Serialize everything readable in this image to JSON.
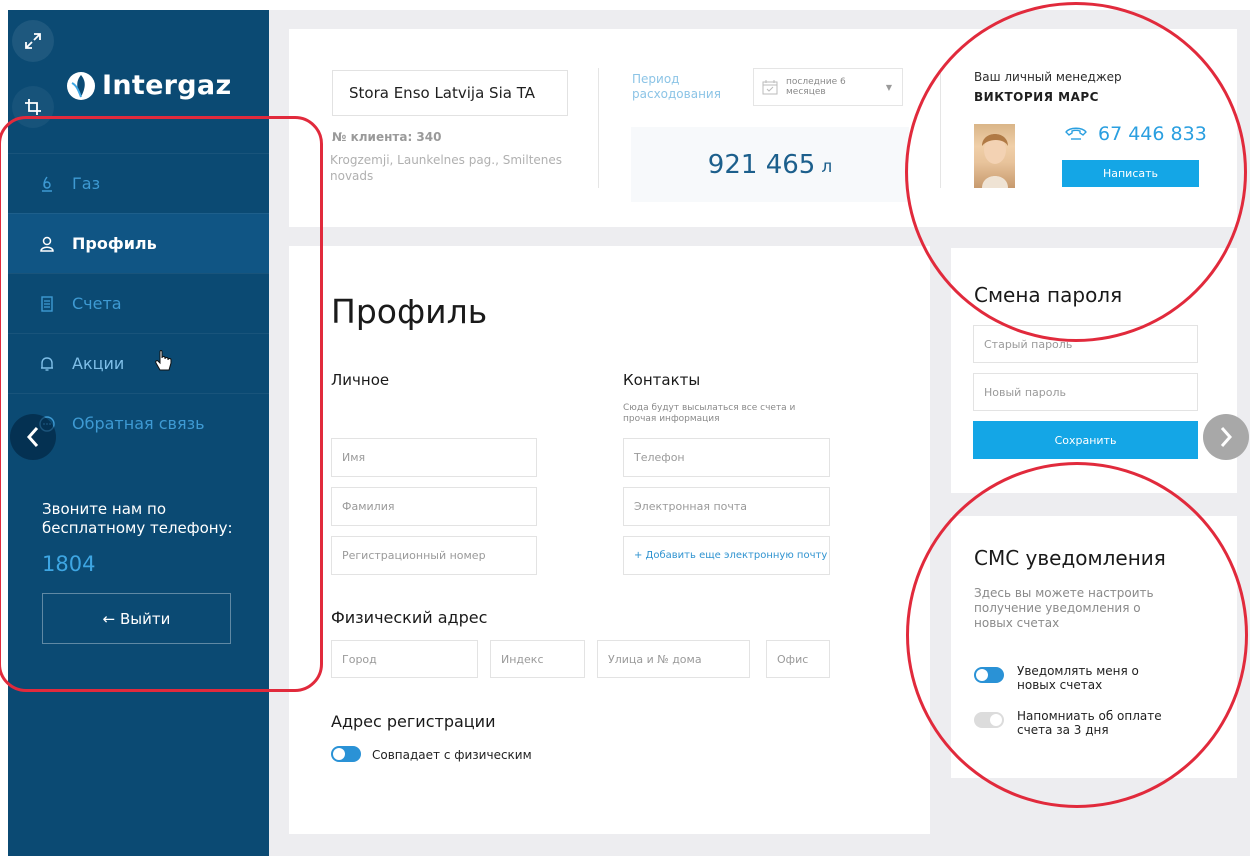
{
  "sidebar": {
    "brand": "Intergaz",
    "nav": [
      {
        "label": "Газ",
        "icon": "flame-icon",
        "active": false
      },
      {
        "label": "Профиль",
        "icon": "user-icon",
        "active": true
      },
      {
        "label": "Счета",
        "icon": "document-icon",
        "active": false
      },
      {
        "label": "Акции",
        "icon": "bell-icon",
        "active": false
      },
      {
        "label": "Обратная связь",
        "icon": "chat-icon",
        "active": false
      }
    ],
    "call_text": "Звоните нам по бесплатному телефону:",
    "call_number": "1804",
    "logout_label": "← Выйти"
  },
  "header": {
    "company": "Stora Enso Latvija Sia TA",
    "client_no": "№ клиента: 340",
    "address": "Krogzemji, Launkelnes pag., Smiltenes novads",
    "period_label": "Период расходования",
    "period_value": "последние 6 месяцев",
    "volume": "921 465",
    "volume_unit": "л",
    "manager_title": "Ваш личный менеджер",
    "manager_name": "ВИКТОРИЯ МАРС",
    "manager_phone": "67 446 833",
    "write_button": "Написать"
  },
  "profile": {
    "title": "Профиль",
    "personal_title": "Личное",
    "contacts_title": "Контакты",
    "contacts_note": "Сюда будут высылаться все счета и прочая информация",
    "fields": {
      "name": "Имя",
      "surname": "Фамилия",
      "reg_number": "Регистрационный номер",
      "phone": "Телефон",
      "email": "Электронная почта",
      "add_email": "+ Добавить еще электронную почту"
    },
    "address_title": "Физический адрес",
    "address_fields": {
      "city": "Город",
      "index": "Индекс",
      "street": "Улица и № дома",
      "office": "Офис"
    },
    "reg_address_title": "Адрес регистрации",
    "same_as_physical": "Совпадает с физическим"
  },
  "password": {
    "title": "Смена пароля",
    "old_placeholder": "Старый пароль",
    "new_placeholder": "Новый пароль",
    "save_button": "Сохранить"
  },
  "sms": {
    "title": "СМС уведомления",
    "description": "Здесь вы можете настроить получение уведомления о новых счетах",
    "option1": "Уведомлять меня о новых счетах",
    "option1_on": true,
    "option2": "Напомниать об оплате счета за 3 дня",
    "option2_on": false
  },
  "colors": {
    "sidebar_bg": "#0b4a73",
    "accent": "#14a6e6",
    "annotation": "#e12a3c"
  }
}
